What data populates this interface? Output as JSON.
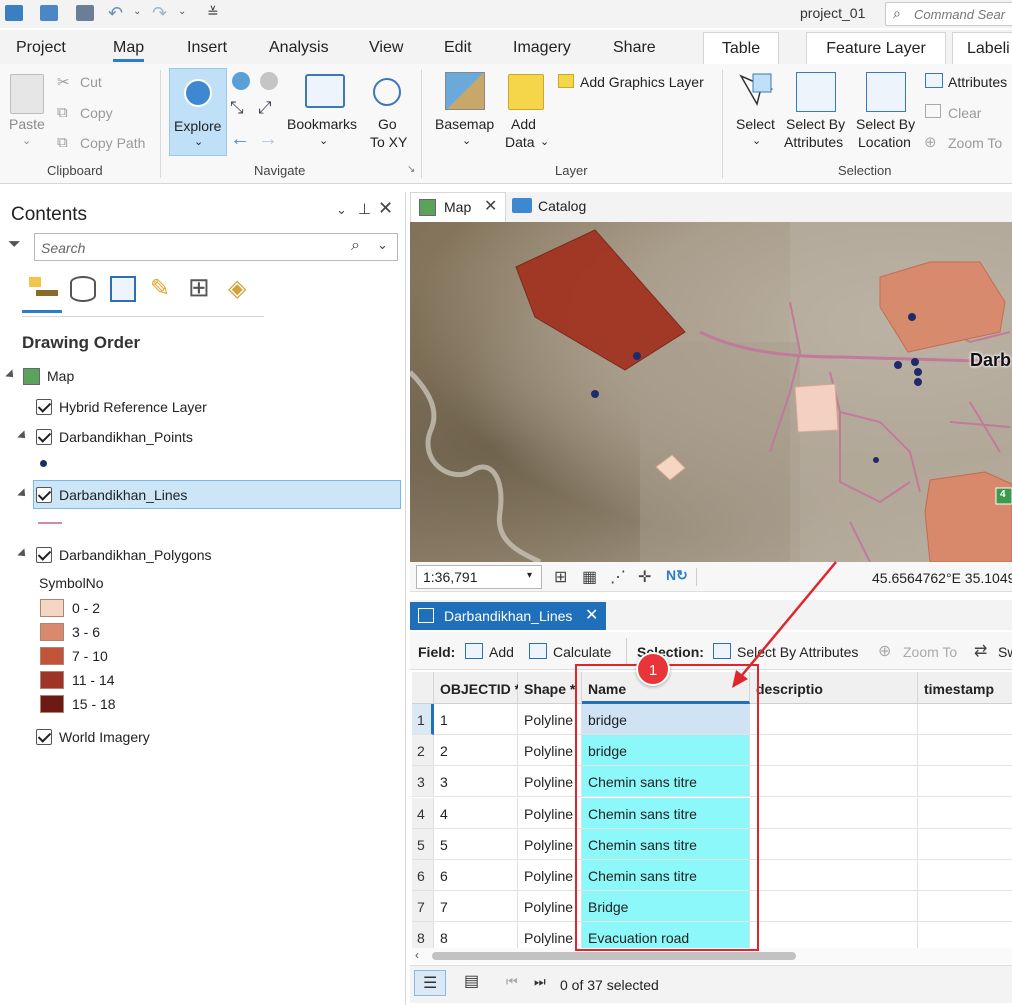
{
  "titlebar": {
    "project": "project_01",
    "command_search_placeholder": "Command Sear"
  },
  "ribbon_tabs": {
    "project": "Project",
    "map": "Map",
    "insert": "Insert",
    "analysis": "Analysis",
    "view": "View",
    "edit": "Edit",
    "imagery": "Imagery",
    "share": "Share",
    "table": "Table",
    "feature_layer": "Feature Layer",
    "labeling": "Labeli"
  },
  "ribbon": {
    "clipboard": {
      "paste": "Paste",
      "cut": "Cut",
      "copy": "Copy",
      "copy_path": "Copy Path",
      "label": "Clipboard"
    },
    "navigate": {
      "explore": "Explore",
      "bookmarks": "Bookmarks",
      "go_to_xy_1": "Go",
      "go_to_xy_2": "To XY",
      "label": "Navigate"
    },
    "layer": {
      "basemap": "Basemap",
      "add_data_1": "Add",
      "add_data_2": "Data",
      "add_graphics": "Add Graphics Layer",
      "label": "Layer"
    },
    "selection": {
      "select": "Select",
      "by_attr_1": "Select By",
      "by_attr_2": "Attributes",
      "by_loc_1": "Select By",
      "by_loc_2": "Location",
      "attributes": "Attributes",
      "clear": "Clear",
      "zoom_to": "Zoom To",
      "label": "Selection"
    }
  },
  "contents": {
    "title": "Contents",
    "search_placeholder": "Search",
    "drawing_order": "Drawing Order",
    "map": "Map",
    "layers": {
      "hybrid": "Hybrid Reference Layer",
      "points": "Darbandikhan_Points",
      "lines": "Darbandikhan_Lines",
      "polygons": "Darbandikhan_Polygons",
      "symbol_field": "SymbolNo",
      "world_imagery": "World Imagery"
    },
    "classes": [
      {
        "label": "0 - 2",
        "color": "#f5d5c3"
      },
      {
        "label": "3 - 6",
        "color": "#d98a6e"
      },
      {
        "label": "7 - 10",
        "color": "#c0553a"
      },
      {
        "label": "11 - 14",
        "color": "#9c3427"
      },
      {
        "label": "15 - 18",
        "color": "#6e1a14"
      }
    ]
  },
  "map_view": {
    "tab_map": "Map",
    "tab_catalog": "Catalog",
    "scale": "1:36,791",
    "coordinates": "45.6564762°E 35.1049",
    "place_label": "Darb"
  },
  "table_view": {
    "tab": "Darbandikhan_Lines",
    "toolbar": {
      "field": "Field:",
      "add": "Add",
      "calculate": "Calculate",
      "selection": "Selection:",
      "select_by_attributes": "Select By Attributes",
      "zoom_to": "Zoom To",
      "switch": "Sw"
    },
    "columns": [
      "OBJECTID *",
      "Shape *",
      "Name",
      "descriptio",
      "timestamp"
    ],
    "rows": [
      {
        "n": "1",
        "id": "1",
        "shape": "Polyline",
        "name": "bridge"
      },
      {
        "n": "2",
        "id": "2",
        "shape": "Polyline",
        "name": "bridge"
      },
      {
        "n": "3",
        "id": "3",
        "shape": "Polyline",
        "name": "Chemin sans titre"
      },
      {
        "n": "4",
        "id": "4",
        "shape": "Polyline",
        "name": "Chemin sans titre"
      },
      {
        "n": "5",
        "id": "5",
        "shape": "Polyline",
        "name": "Chemin sans titre"
      },
      {
        "n": "6",
        "id": "6",
        "shape": "Polyline",
        "name": "Chemin sans titre"
      },
      {
        "n": "7",
        "id": "7",
        "shape": "Polyline",
        "name": "Bridge"
      },
      {
        "n": "8",
        "id": "8",
        "shape": "Polyline",
        "name": "Evacuation road"
      }
    ],
    "status": "0 of 37 selected"
  },
  "annotation": {
    "badge": "1",
    "color": "#e0262d"
  }
}
